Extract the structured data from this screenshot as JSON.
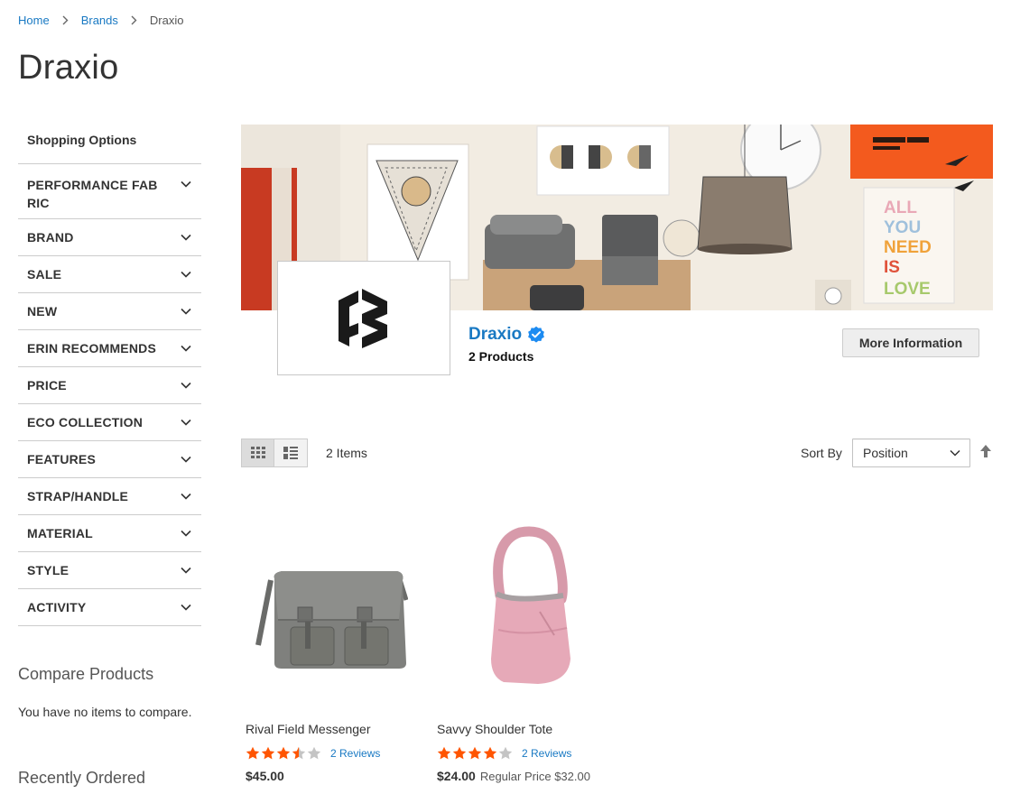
{
  "breadcrumb": [
    {
      "label": "Home"
    },
    {
      "label": "Brands"
    },
    {
      "label": "Draxio"
    }
  ],
  "page_title": "Draxio",
  "sidebar": {
    "title": "Shopping Options",
    "filters": [
      {
        "label": "PERFORMANCE FABRIC"
      },
      {
        "label": "BRAND"
      },
      {
        "label": "SALE"
      },
      {
        "label": "NEW"
      },
      {
        "label": "ERIN RECOMMENDS"
      },
      {
        "label": "PRICE"
      },
      {
        "label": "ECO COLLECTION"
      },
      {
        "label": "FEATURES"
      },
      {
        "label": "STRAP/HANDLE"
      },
      {
        "label": "MATERIAL"
      },
      {
        "label": "STYLE"
      },
      {
        "label": "ACTIVITY"
      }
    ],
    "compare_title": "Compare Products",
    "compare_text": "You have no items to compare.",
    "recent_title": "Recently Ordered"
  },
  "brand": {
    "name": "Draxio",
    "product_count": "2 Products",
    "more_info_label": "More Information",
    "verified_icon": "verified-badge-icon",
    "banner_poster_text": [
      "ALL",
      "YOU",
      "NEED",
      "IS",
      "LOVE"
    ]
  },
  "toolbar": {
    "item_count": "2 Items",
    "sort_label": "Sort By",
    "sort_value": "Position",
    "view_modes": [
      "grid",
      "list"
    ],
    "active_view": "grid"
  },
  "products": [
    {
      "name": "Rival Field Messenger",
      "rating": 3.5,
      "reviews": "2  Reviews",
      "price": "$45.00",
      "regular_price": ""
    },
    {
      "name": "Savvy Shoulder Tote",
      "rating": 4,
      "reviews": "2  Reviews",
      "price": "$24.00",
      "regular_price": "Regular Price $32.00"
    }
  ],
  "colors": {
    "link": "#1979c3",
    "star": "#ff5501",
    "star_empty": "#c4c4c4",
    "text": "#333333"
  }
}
